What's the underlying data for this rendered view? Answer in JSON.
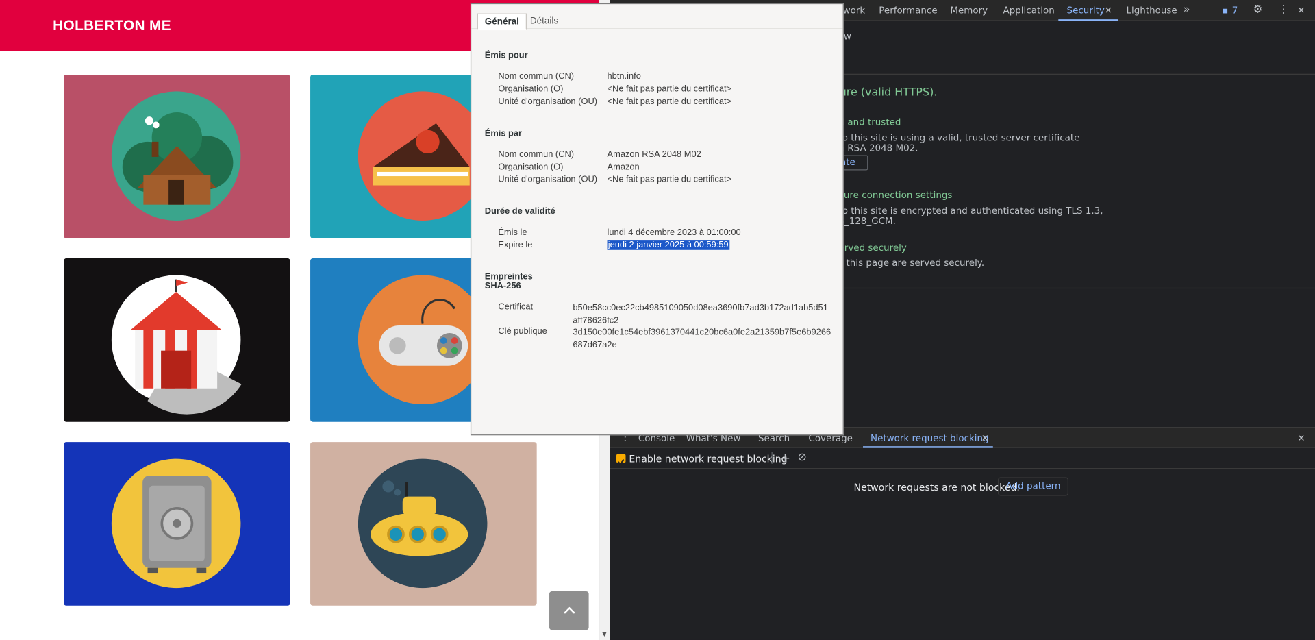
{
  "site": {
    "brand": "HOLBERTON ME"
  },
  "devtools": {
    "tabs": [
      "work",
      "Performance",
      "Memory",
      "Application",
      "Security",
      "Lighthouse"
    ],
    "active_tab": "Security",
    "issues_count": "7",
    "security": {
      "overview_fragment": "w",
      "secure_heading": "ure (valid HTTPS).",
      "cert_title": "d and trusted",
      "cert_line1": "to this site is using a valid, trusted server certificate",
      "cert_line2": "n RSA 2048 M02.",
      "view_cert_button": "ate",
      "conn_title": "cure connection settings",
      "conn_line1": "to this site is encrypted and authenticated using TLS 1.3,",
      "conn_line2": "S_128_GCM.",
      "res_title": "erved securely",
      "res_line1": "this page are served securely."
    },
    "drawer": {
      "tabs": [
        "Console",
        "What's New",
        "Search",
        "Coverage",
        "Network request blocking"
      ],
      "active_tab": "Network request blocking",
      "enable_label": "Enable network request blocking",
      "enabled": true,
      "status": "Network requests are not blocked.",
      "add_pattern": "Add pattern"
    }
  },
  "certificate": {
    "tab_general": "Général",
    "tab_details": "Détails",
    "issued_to": {
      "heading": "Émis pour",
      "cn_label": "Nom commun (CN)",
      "cn": "hbtn.info",
      "o_label": "Organisation (O)",
      "o": "<Ne fait pas partie du certificat>",
      "ou_label": "Unité d'organisation (OU)",
      "ou": "<Ne fait pas partie du certificat>"
    },
    "issued_by": {
      "heading": "Émis par",
      "cn_label": "Nom commun (CN)",
      "cn": "Amazon RSA 2048 M02",
      "o_label": "Organisation (O)",
      "o": "Amazon",
      "ou_label": "Unité d'organisation (OU)",
      "ou": "<Ne fait pas partie du certificat>"
    },
    "validity": {
      "heading": "Durée de validité",
      "issued_label": "Émis le",
      "issued": "lundi 4 décembre 2023 à 01:00:00",
      "expires_label": "Expire le",
      "expires": "jeudi 2 janvier 2025 à 00:59:59"
    },
    "fingerprints": {
      "heading": "Empreintes SHA-256",
      "cert_label": "Certificat",
      "cert": "b50e58cc0ec22cb4985109050d08ea3690fb7ad3b172ad1ab5d51aff78626fc2",
      "key_label": "Clé publique",
      "key": "3d150e00fe1c54ebf3961370441c20bc6a0fe2a21359b7f5e6b9266687d67a2e"
    }
  }
}
